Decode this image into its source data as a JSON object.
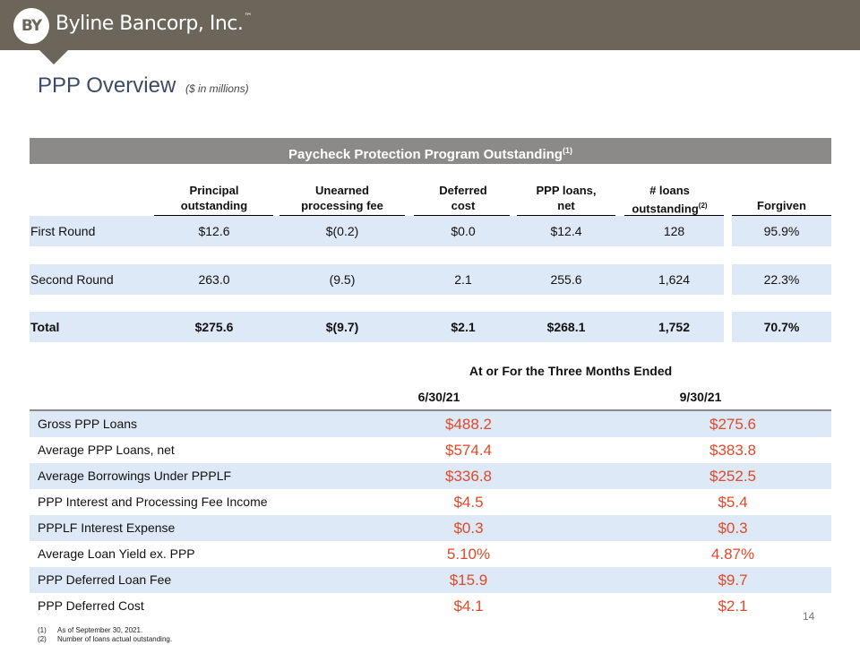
{
  "header": {
    "logo_mark": "BY",
    "brand": "Byline Bancorp, Inc.",
    "brand_tm": "™"
  },
  "title": {
    "main": "PPP Overview",
    "sub": "($ in millions)"
  },
  "ppp_table": {
    "title": "Paycheck Protection Program Outstanding",
    "title_note": "(1)",
    "columns": [
      {
        "line1": "Principal",
        "line2": "outstanding",
        "note": ""
      },
      {
        "line1": "Unearned",
        "line2": "processing fee",
        "note": ""
      },
      {
        "line1": "Deferred",
        "line2": "cost",
        "note": ""
      },
      {
        "line1": "PPP loans,",
        "line2": "net",
        "note": ""
      },
      {
        "line1": "# loans",
        "line2": "outstanding",
        "note": "(2)"
      },
      {
        "line1": "",
        "line2": "Forgiven",
        "note": ""
      }
    ],
    "rows": [
      {
        "label": "First Round",
        "values": [
          "$12.6",
          "$(0.2)",
          "$0.0",
          "$12.4",
          "128",
          "95.9%"
        ]
      },
      {
        "label": "Second Round",
        "values": [
          "263.0",
          "(9.5)",
          "2.1",
          "255.6",
          "1,624",
          "22.3%"
        ]
      },
      {
        "label": "Total",
        "values": [
          "$275.6",
          "$(9.7)",
          "$2.1",
          "$268.1",
          "1,752",
          "70.7%"
        ]
      }
    ]
  },
  "metrics_table": {
    "caption": "At or For the Three Months Ended",
    "columns": [
      "6/30/21",
      "9/30/21"
    ],
    "rows": [
      {
        "label": "Gross PPP Loans",
        "v1": "$488.2",
        "v2": "$275.6"
      },
      {
        "label": "Average PPP Loans, net",
        "v1": "$574.4",
        "v2": "$383.8"
      },
      {
        "label": "Average Borrowings Under PPPLF",
        "v1": "$336.8",
        "v2": "$252.5"
      },
      {
        "label": "PPP Interest and Processing Fee Income",
        "v1": "$4.5",
        "v2": "$5.4"
      },
      {
        "label": "PPPLF Interest Expense",
        "v1": "$0.3",
        "v2": "$0.3"
      },
      {
        "label": "Average Loan Yield ex. PPP",
        "v1": "5.10%",
        "v2": "4.87%"
      },
      {
        "label": "PPP Deferred Loan Fee",
        "v1": "$15.9",
        "v2": "$9.7"
      },
      {
        "label": "PPP Deferred Cost",
        "v1": "$4.1",
        "v2": "$2.1"
      }
    ]
  },
  "footnotes": [
    {
      "num": "(1)",
      "text": "As of September 30, 2021."
    },
    {
      "num": "(2)",
      "text": "Number of loans actual outstanding."
    }
  ],
  "page_number": "14",
  "colors": {
    "header_bar": "#6b6659",
    "title": "#3d4a63",
    "band": "#8c8a89",
    "row_shade": "#dde9f6",
    "accent_value": "#e0492a"
  }
}
